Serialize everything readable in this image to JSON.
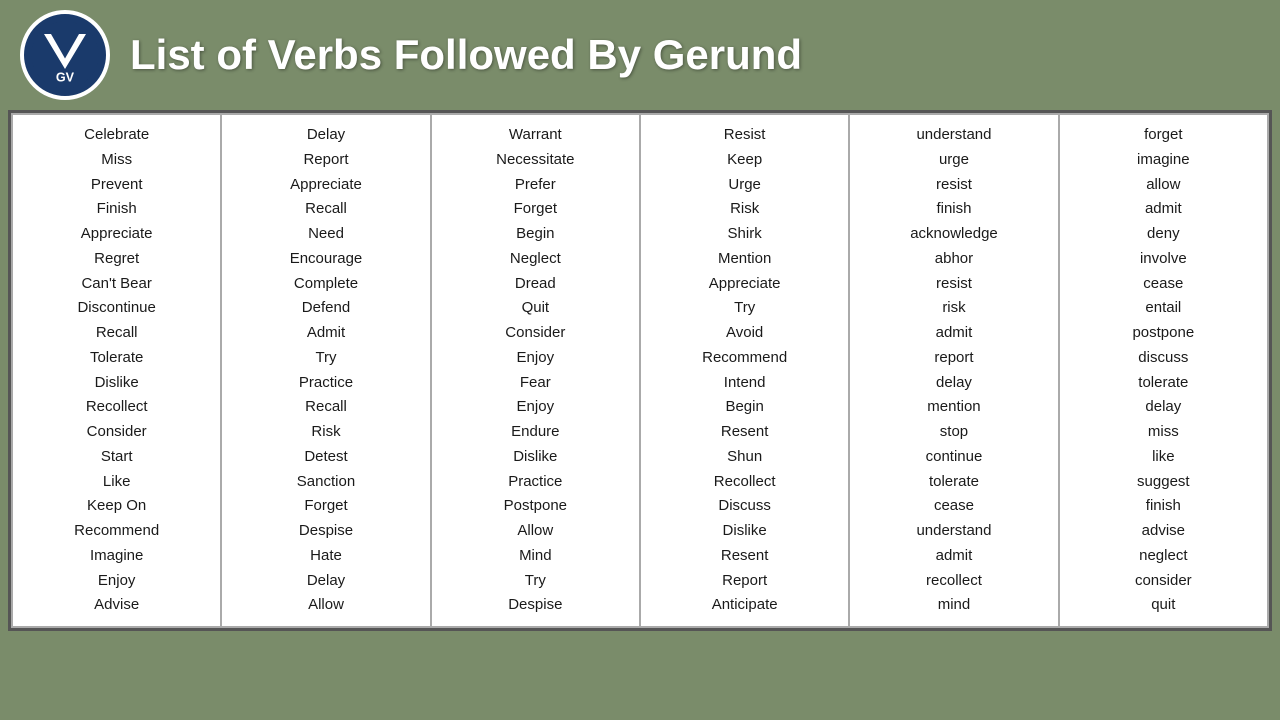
{
  "header": {
    "title": "List of Verbs Followed By Gerund"
  },
  "columns": [
    {
      "words": [
        "Celebrate",
        "Miss",
        "Prevent",
        "Finish",
        "Appreciate",
        "Regret",
        "Can't Bear",
        "Discontinue",
        "Recall",
        "Tolerate",
        "Dislike",
        "Recollect",
        "Consider",
        "Start",
        "Like",
        "Keep On",
        "Recommend",
        "Imagine",
        "Enjoy",
        "Advise"
      ]
    },
    {
      "words": [
        "Delay",
        "Report",
        "Appreciate",
        "Recall",
        "Need",
        "Encourage",
        "Complete",
        "Defend",
        "Admit",
        "Try",
        "Practice",
        "Recall",
        "Risk",
        "Detest",
        "Sanction",
        "Forget",
        "Despise",
        "Hate",
        "Delay",
        "Allow"
      ]
    },
    {
      "words": [
        "Warrant",
        "Necessitate",
        "Prefer",
        "Forget",
        "Begin",
        "Neglect",
        "Dread",
        "Quit",
        "Consider",
        "Enjoy",
        "Fear",
        "Enjoy",
        "Endure",
        "Dislike",
        "Practice",
        "Postpone",
        "Allow",
        "Mind",
        "Try",
        "Despise"
      ]
    },
    {
      "words": [
        "Resist",
        "Keep",
        "Urge",
        "Risk",
        "Shirk",
        "Mention",
        "Appreciate",
        "Try",
        "Avoid",
        "Recommend",
        "Intend",
        "Begin",
        "Resent",
        "Shun",
        "Recollect",
        "Discuss",
        "Dislike",
        "Resent",
        "Report",
        "Anticipate"
      ]
    },
    {
      "words": [
        "understand",
        "urge",
        "resist",
        "finish",
        "acknowledge",
        "abhor",
        "resist",
        "risk",
        "admit",
        "report",
        "delay",
        "mention",
        "stop",
        "continue",
        "tolerate",
        "cease",
        "understand",
        "admit",
        "recollect",
        "mind"
      ]
    },
    {
      "words": [
        "forget",
        "imagine",
        "allow",
        "admit",
        "deny",
        "involve",
        "cease",
        "entail",
        "postpone",
        "discuss",
        "tolerate",
        "delay",
        "miss",
        "like",
        "suggest",
        "finish",
        "advise",
        "neglect",
        "consider",
        "quit"
      ]
    }
  ]
}
